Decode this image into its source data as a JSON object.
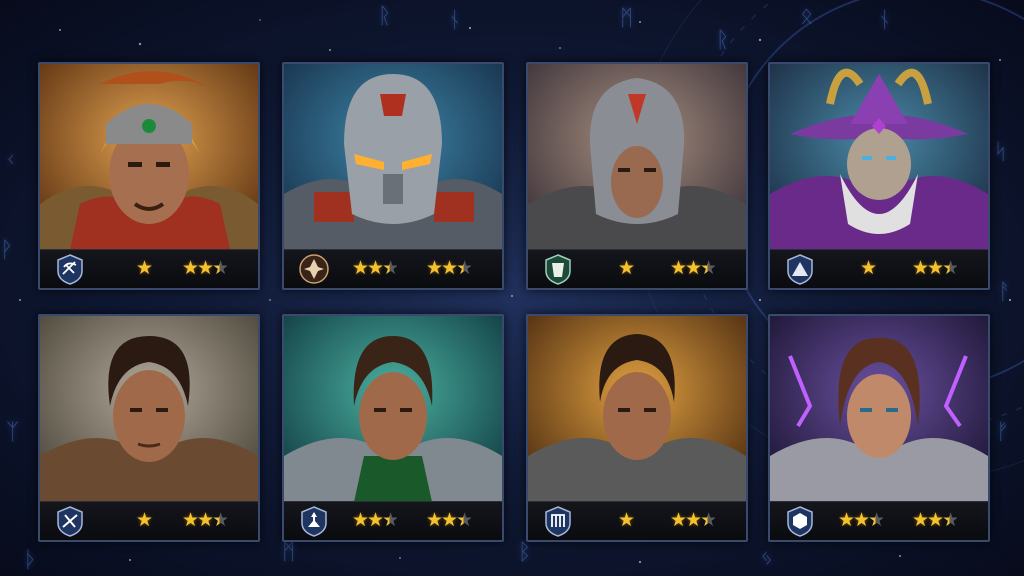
{
  "colors": {
    "background": "#0c1430",
    "rune_glow": "#4f73b8",
    "star_gold": "#f2c230",
    "star_empty": "#5a5a5a",
    "card_border": "#3a4a6e"
  },
  "background": {
    "runes": [
      "ᚱ",
      "ᚾ",
      "ᛗ",
      "ᚱ",
      "ᛟ",
      "ᚾ",
      "ᚲ",
      "ᚹ",
      "ᛉ",
      "ᚦ",
      "ᛋ",
      "ᚨ",
      "ᚠ",
      "ᛗ",
      "ᛒ",
      "ᛃ"
    ]
  },
  "heroes": [
    {
      "portrait": "golden-helmet-warrior",
      "class_icon": "blade-swirl-icon",
      "primary_rating": 1,
      "secondary_rating": 2.5
    },
    {
      "portrait": "steel-robot-knight",
      "class_icon": "crest-emblem-icon",
      "primary_rating": 2.5,
      "secondary_rating": 2.5
    },
    {
      "portrait": "visored-steel-knight",
      "class_icon": "shield-tower-icon",
      "primary_rating": 1,
      "secondary_rating": 2.5
    },
    {
      "portrait": "horned-hat-wizard",
      "class_icon": "mountain-peak-icon",
      "primary_rating": 1,
      "secondary_rating": 2.5
    },
    {
      "portrait": "dark-haired-warrior",
      "class_icon": "crossed-blades-icon",
      "primary_rating": 1,
      "secondary_rating": 2.5
    },
    {
      "portrait": "green-cloak-warrior",
      "class_icon": "knight-figure-icon",
      "primary_rating": 2.5,
      "secondary_rating": 2.5
    },
    {
      "portrait": "ember-lit-warrior",
      "class_icon": "gate-rune-icon",
      "primary_rating": 1,
      "secondary_rating": 2.5
    },
    {
      "portrait": "scarred-heroine",
      "class_icon": "hex-crest-icon",
      "primary_rating": 2.5,
      "secondary_rating": 2.5
    }
  ]
}
